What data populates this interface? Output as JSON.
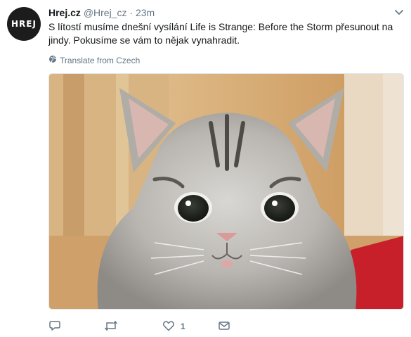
{
  "tweet": {
    "avatar_text": "HREJ",
    "display_name": "Hrej.cz",
    "handle": "@Hrej_cz",
    "separator": "·",
    "time": "23m",
    "text": "S lítostí musíme dnešní vysílání Life is Strange: Before the Storm přesunout na jindy. Pokusíme se vám to nějak vynahradit.",
    "translate_label": "Translate from Czech"
  },
  "actions": {
    "reply_count": "",
    "retweet_count": "",
    "like_count": "1",
    "dm_count": ""
  },
  "icons": {
    "globe": "globe-icon",
    "reply": "reply-icon",
    "retweet": "retweet-icon",
    "like": "heart-icon",
    "dm": "envelope-icon",
    "caret": "chevron-down-icon"
  },
  "colors": {
    "text": "#14171a",
    "secondary": "#657786",
    "avatar_bg": "#1c1c1c"
  }
}
